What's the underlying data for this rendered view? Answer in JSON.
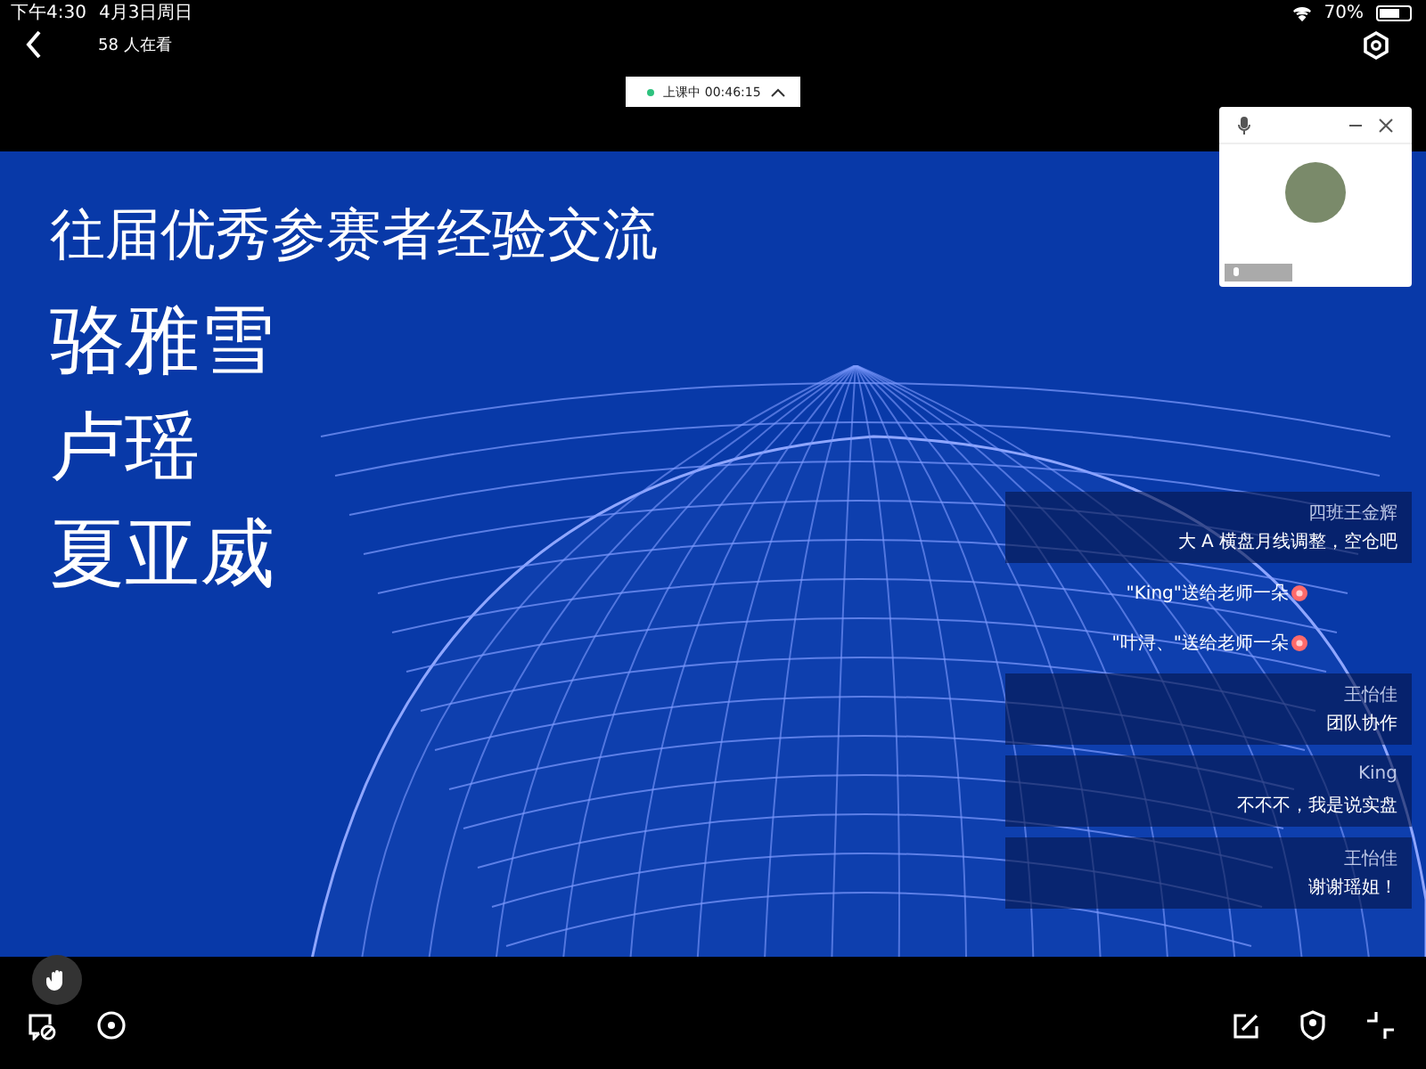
{
  "status_bar": {
    "time": "下午4:30",
    "date": "4月3日周日",
    "battery": "70%"
  },
  "header": {
    "viewers": "58 人在看"
  },
  "live_pill": {
    "status": "上课中",
    "timer": "00:46:15"
  },
  "slide": {
    "title": "往届优秀参赛者经验交流",
    "names": [
      "骆雅雪",
      "卢瑶",
      "夏亚威"
    ]
  },
  "chat": [
    {
      "kind": "message",
      "name": "四班王金辉",
      "text": "大 A 横盘月线调整，空仓吧"
    },
    {
      "kind": "gift",
      "text": "\"King\"送给老师一朵"
    },
    {
      "kind": "gift",
      "text": "\"叶浔、\"送给老师一朵"
    },
    {
      "kind": "message",
      "name": "王怡佳",
      "text": "团队协作"
    },
    {
      "kind": "message",
      "name": "King",
      "text": "不不不，我是说实盘"
    },
    {
      "kind": "message",
      "name": "王怡佳",
      "text": "谢谢瑶姐！"
    }
  ]
}
